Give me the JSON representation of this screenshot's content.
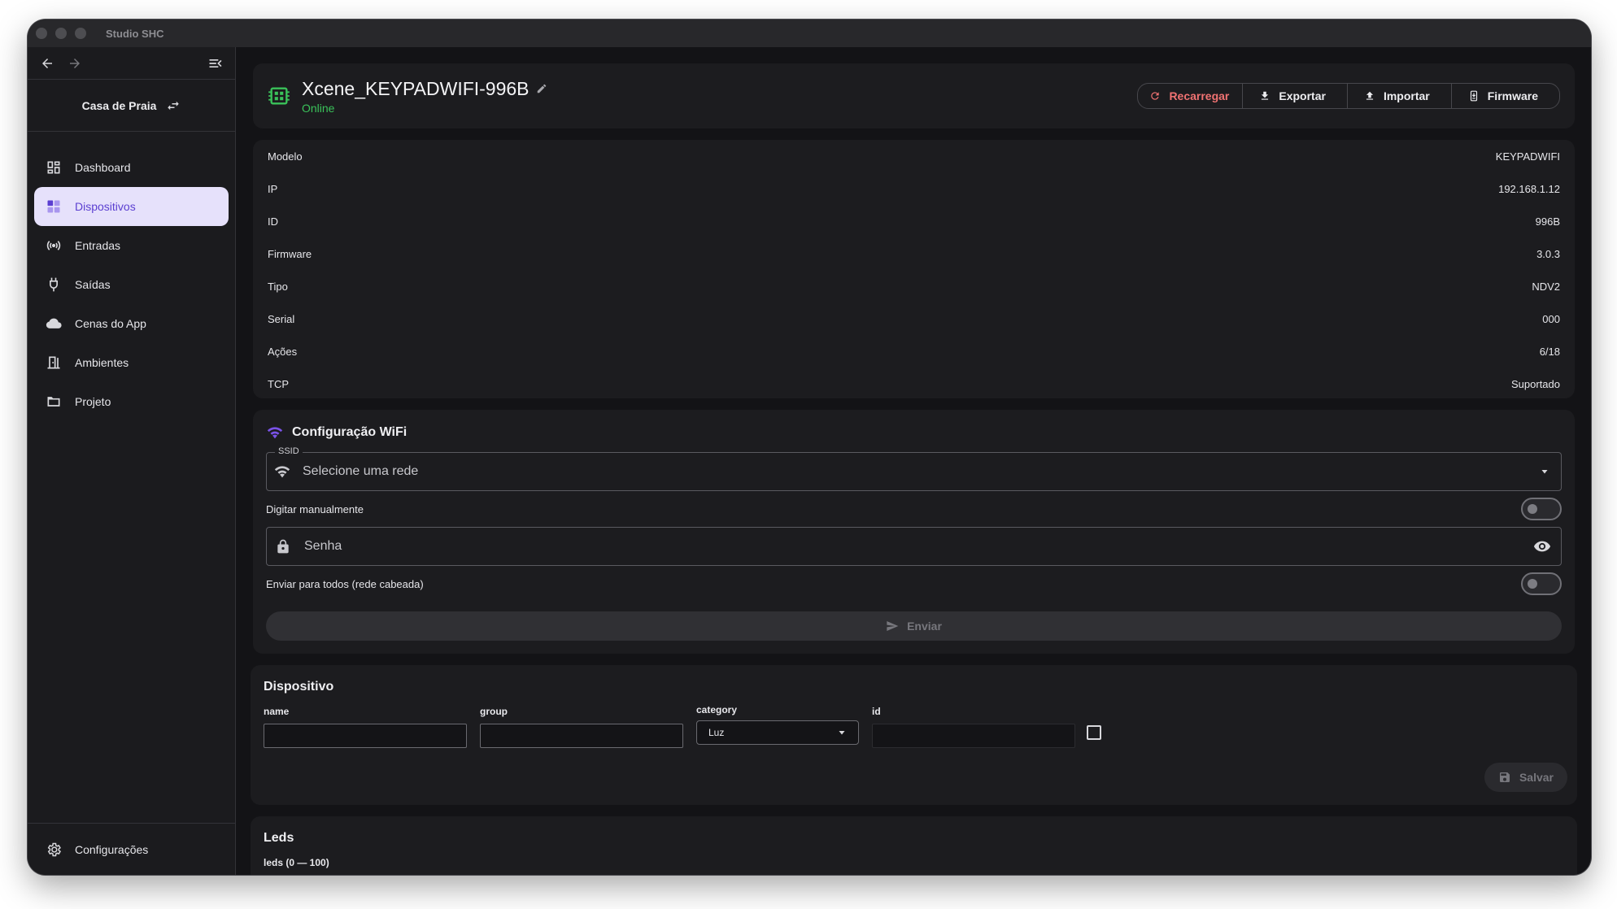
{
  "window": {
    "title": "Studio SHC"
  },
  "sidebar": {
    "project_name": "Casa de Praia",
    "items": [
      {
        "label": "Dashboard",
        "icon": "dashboard-icon",
        "active": false
      },
      {
        "label": "Dispositivos",
        "icon": "devices-icon",
        "active": true
      },
      {
        "label": "Entradas",
        "icon": "broadcast-icon",
        "active": false
      },
      {
        "label": "Saídas",
        "icon": "plug-icon",
        "active": false
      },
      {
        "label": "Cenas do App",
        "icon": "cloud-icon",
        "active": false
      },
      {
        "label": "Ambientes",
        "icon": "door-icon",
        "active": false
      },
      {
        "label": "Projeto",
        "icon": "folder-icon",
        "active": false
      }
    ],
    "settings_label": "Configurações"
  },
  "device": {
    "name": "Xcene_KEYPADWIFI-996B",
    "status": "Online",
    "status_color": "#3ac25a",
    "actions": {
      "reload": "Recarregar",
      "export": "Exportar",
      "import": "Importar",
      "firmware": "Firmware"
    }
  },
  "info": [
    {
      "label": "Modelo",
      "value": "KEYPADWIFI"
    },
    {
      "label": "IP",
      "value": "192.168.1.12"
    },
    {
      "label": "ID",
      "value": "996B"
    },
    {
      "label": "Firmware",
      "value": "3.0.3"
    },
    {
      "label": "Tipo",
      "value": "NDV2"
    },
    {
      "label": "Serial",
      "value": "000"
    },
    {
      "label": "Ações",
      "value": "6/18"
    },
    {
      "label": "TCP",
      "value": "Suportado"
    }
  ],
  "wifi": {
    "title": "Configuração WiFi",
    "ssid_legend": "SSID",
    "ssid_placeholder": "Selecione uma rede",
    "manual_label": "Digitar manualmente",
    "password_placeholder": "Senha",
    "broadcast_label": "Enviar para todos (rede cabeada)",
    "send_label": "Enviar"
  },
  "device_form": {
    "title": "Dispositivo",
    "name_label": "name",
    "group_label": "group",
    "category_label": "category",
    "category_value": "Luz",
    "id_label": "id",
    "save_label": "Salvar"
  },
  "leds": {
    "title": "Leds",
    "label": "leds (0 — 100)"
  },
  "colors": {
    "accent": "#5b3fd1",
    "accent_bg": "#e6e1fb",
    "danger": "#f07272",
    "wifi_icon": "#7a52e8",
    "device_icon": "#3ac25a"
  }
}
